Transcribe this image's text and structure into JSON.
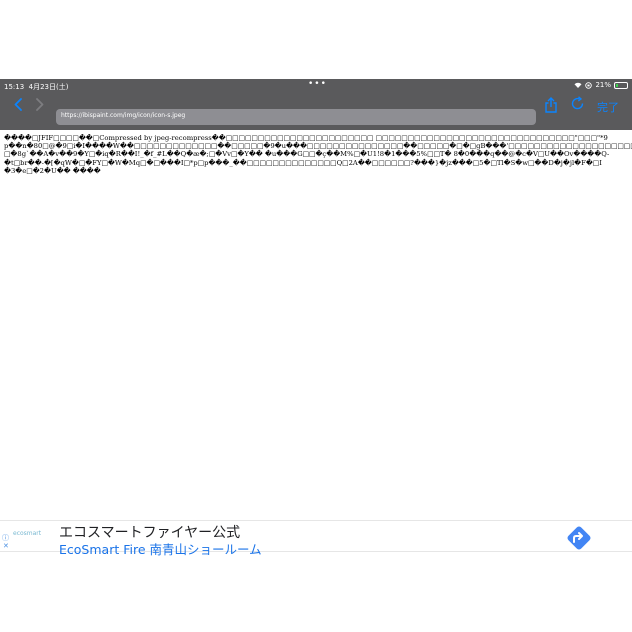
{
  "status_bar": {
    "time": "15:13",
    "date": "4月23日(土)",
    "center_dots": "•••",
    "battery": "21%",
    "battery_level": 0.21
  },
  "browser": {
    "back_icon": "chevron-left-icon",
    "forward_icon": "chevron-right-icon",
    "url": "https://ibispaint.com/img/icon/icon-s.jpeg",
    "share_icon": "share-icon",
    "reload_icon": "reload-icon",
    "done_label": "完了",
    "accent_color": "#0a84ff"
  },
  "content": {
    "lines": [
      "����□JFIF□□□□��□Compressed by jpeg-recompress��□□□□□□□□□□□□□□□□□□□□□□□ □□□□□□□□□□□□□□□□□□□□□□□□□□□□□□□\"□□□\"*9",
      "p��n�80□@�9□i�I����W��□□□□□□□□□□□□□��□□□□□�9�u���□□□□□□□□□□□□□□□��□□□□□�□�□gB���'□□□□□□□□□□□□□□□□□□□□□□□!□□\"1q� R2",
      "□�8g`��A�v��9�Y□�iq�R��I!_�f_#L��Q�æ�;□�Vv□�Y�� �u���G□□�ç��M%□�U1!8�1���5%□□T� 8�0���q��@�c�V□U��Ov����Q-",
      "�t□br��-�[�qW�□�FY□�W�Mq□�□���I□*p□p���_��□□□□□□□□□□□□□□Q□2A��□□□□□□?���}�jz���□5�□Tl�S�w□��D�j�jl�F�□I",
      "�3�e□�2�U�� ����"
    ]
  },
  "ad": {
    "info_icon": "info-icon",
    "close_icon": "close-icon",
    "logo_text": "ecosmart",
    "title": "エコスマートファイヤー公式",
    "subtitle": "EcoSmart Fire 南青山ショールーム",
    "arrow_icon": "directions-arrow-icon",
    "arrow_color": "#4285f4"
  }
}
